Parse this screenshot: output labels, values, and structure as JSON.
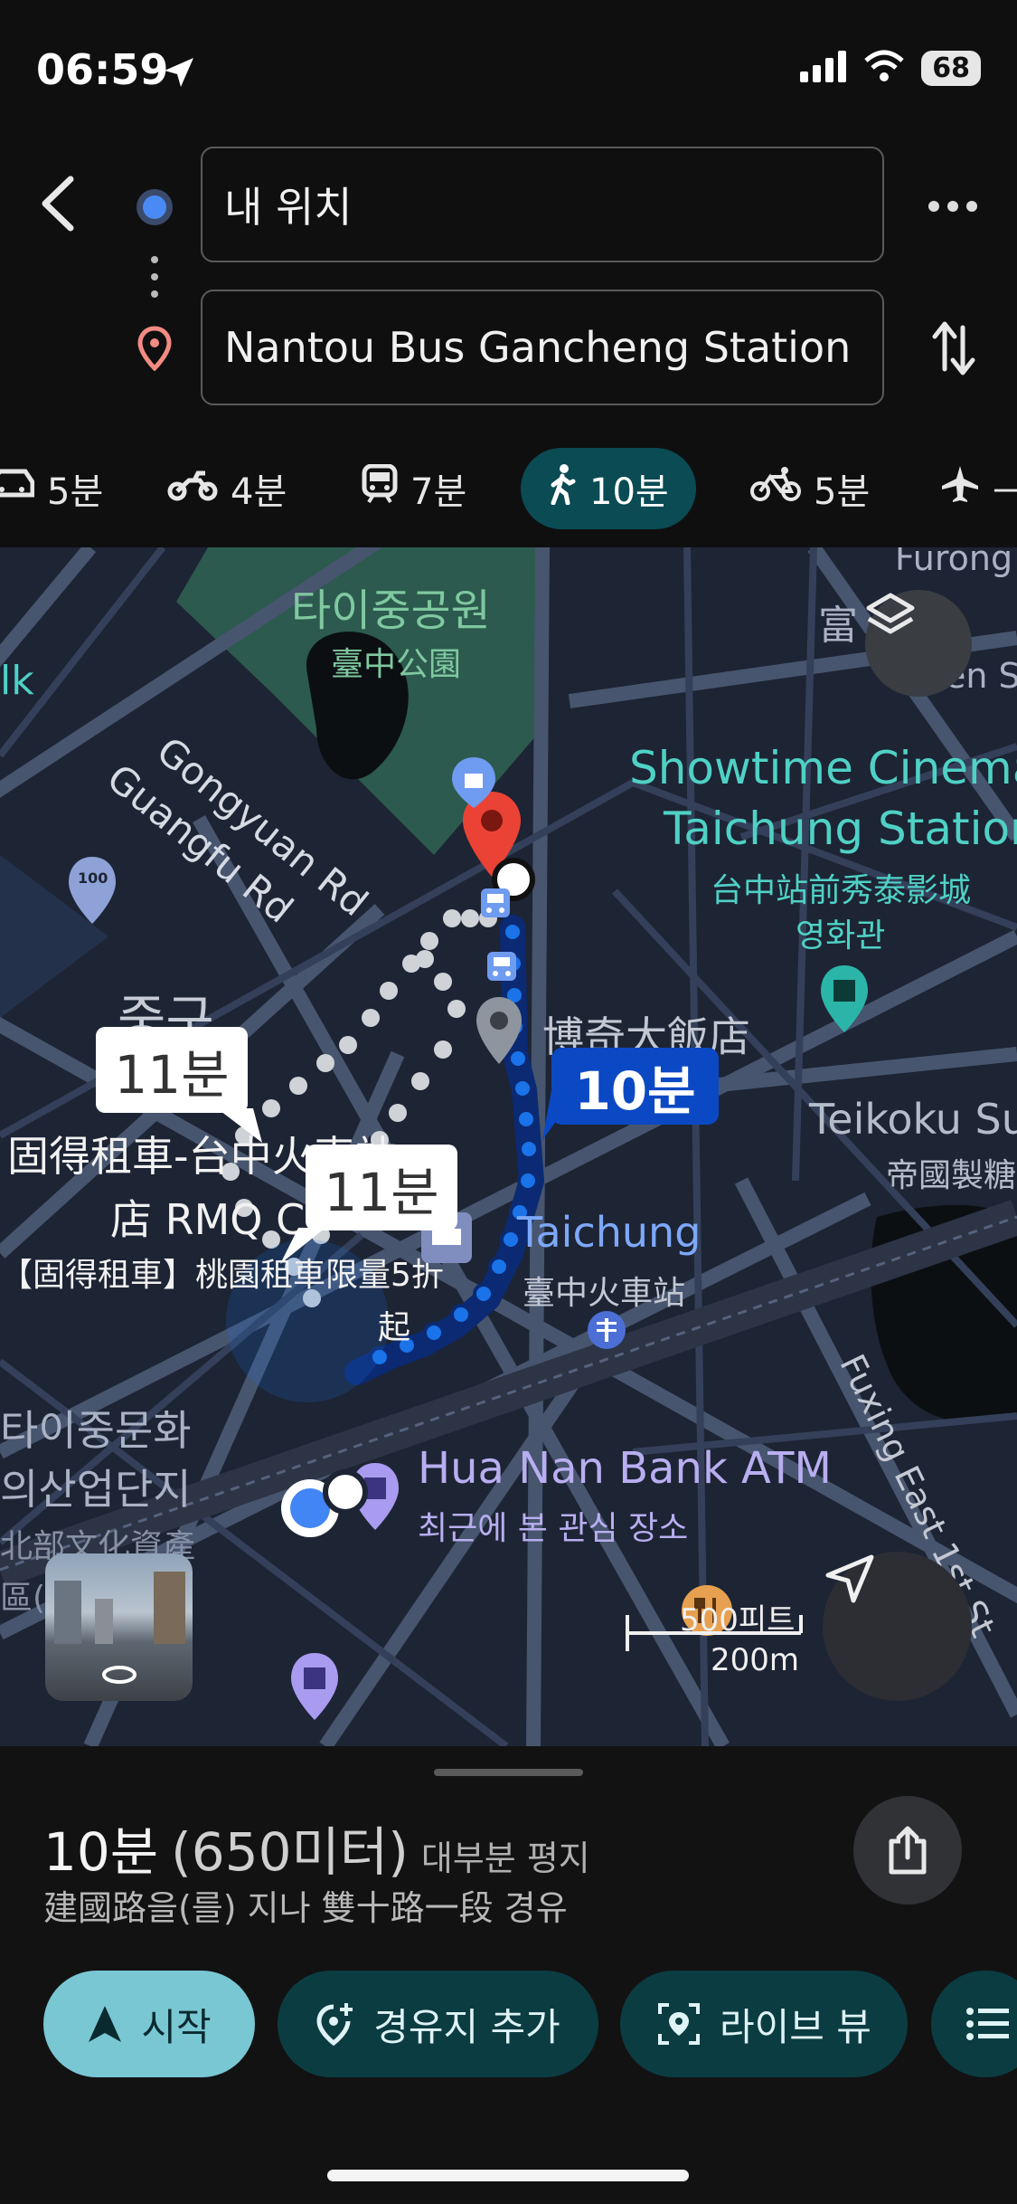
{
  "status": {
    "time": "06:59",
    "battery": "68"
  },
  "header": {
    "origin": "내 위치",
    "destination": "Nantou Bus Gancheng Station"
  },
  "modes": [
    {
      "icon": "car-icon",
      "label": "5분"
    },
    {
      "icon": "motorcycle-icon",
      "label": "4분"
    },
    {
      "icon": "train-icon",
      "label": "7분"
    },
    {
      "icon": "walk-icon",
      "label": "10분",
      "active": true
    },
    {
      "icon": "bicycle-icon",
      "label": "5분"
    },
    {
      "icon": "plane-icon",
      "label": "—"
    }
  ],
  "map": {
    "park_ko": "타이중공원",
    "park_zh": "臺中公園",
    "road_gongyuan": "Gongyuan Rd",
    "road_guangfu": "Guangfu Rd",
    "furong": "Furong St",
    "fu_zh": "富",
    "en_st": "en St",
    "lk": "lk",
    "showtime_1": "Showtime Cinema",
    "showtime_2": "Taichung Station",
    "showtime_zh": "台中站前秀泰影城",
    "showtime_ko": "영화관",
    "hotel": "博奇大飯店",
    "teikoku": "Teikoku Su",
    "teikoku_zh": "帝國製糖",
    "district": "중구",
    "rental_1": "固得租車-台中火車站",
    "rental_2": "店 RMQ C",
    "rental_3": "【固得租車】桃園租車限量5折",
    "start_label": "起",
    "station_en": "Taichung",
    "station_zh": "臺中火車站",
    "culture_1": "타이중문화",
    "culture_2": "의산업단지",
    "culture_3": "北部文化資產",
    "culture_4": "區(原",
    "bank": "Hua Nan Bank ATM",
    "bank_sub": "최근에 본 관심 장소",
    "fuxing": "Fuxing East 1st St",
    "bubble_main": "10분",
    "bubble_alt1": "11분",
    "bubble_alt2": "11분",
    "scale_ft": "500피트",
    "scale_m": "200m",
    "badge_100": "100"
  },
  "summary": {
    "duration": "10분",
    "distance": "(650미터)",
    "terrain": "대부분 평지",
    "via": "建國路을(를) 지나 雙十路一段 경유"
  },
  "actions": {
    "start": "시작",
    "add_stop": "경유지 추가",
    "live_view": "라이브 뷰"
  },
  "colors": {
    "accent": "#79c7d3",
    "route_blue": "#1a73e8",
    "pin_red": "#ea4335",
    "park_green": "#2c5a4e",
    "teal_label": "#4fd1c5"
  }
}
